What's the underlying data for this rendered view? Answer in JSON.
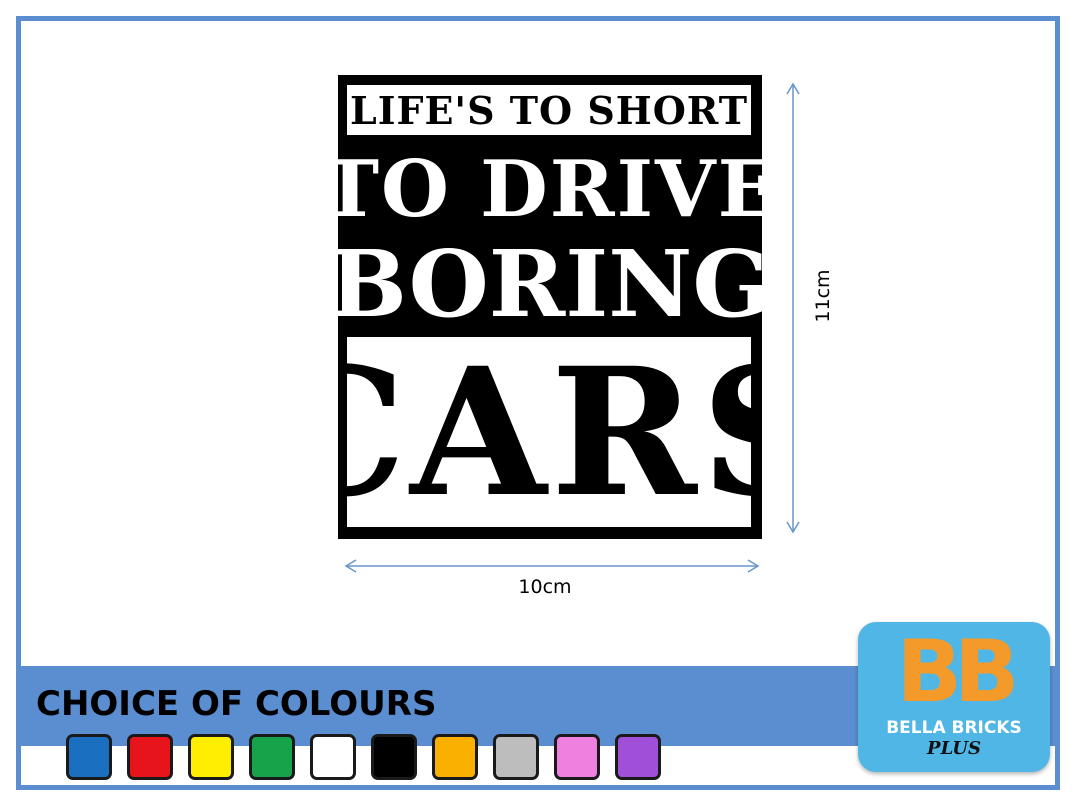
{
  "sticker": {
    "line1": "LIFE'S TO SHORT",
    "line2": "TO DRIVE",
    "line3": "BORING",
    "line4": "CARS"
  },
  "dimensions": {
    "width_label": "10cm",
    "height_label": "11cm"
  },
  "colours_section": {
    "title": "CHOICE OF COLOURS",
    "swatches": [
      "#1a6fc0",
      "#e8141c",
      "#ffee00",
      "#16a34a",
      "#ffffff",
      "#000000",
      "#f9b000",
      "#bdbdbd",
      "#f080e0",
      "#a050d8"
    ]
  },
  "logo": {
    "monogram": "BB",
    "name": "BELLA BRICKS",
    "sub": "PLUS"
  },
  "colors": {
    "frame": "#5b8ed0",
    "band": "#5b8ed0",
    "logo_bg": "#4fb6e6",
    "logo_mark": "#f39a2a"
  }
}
